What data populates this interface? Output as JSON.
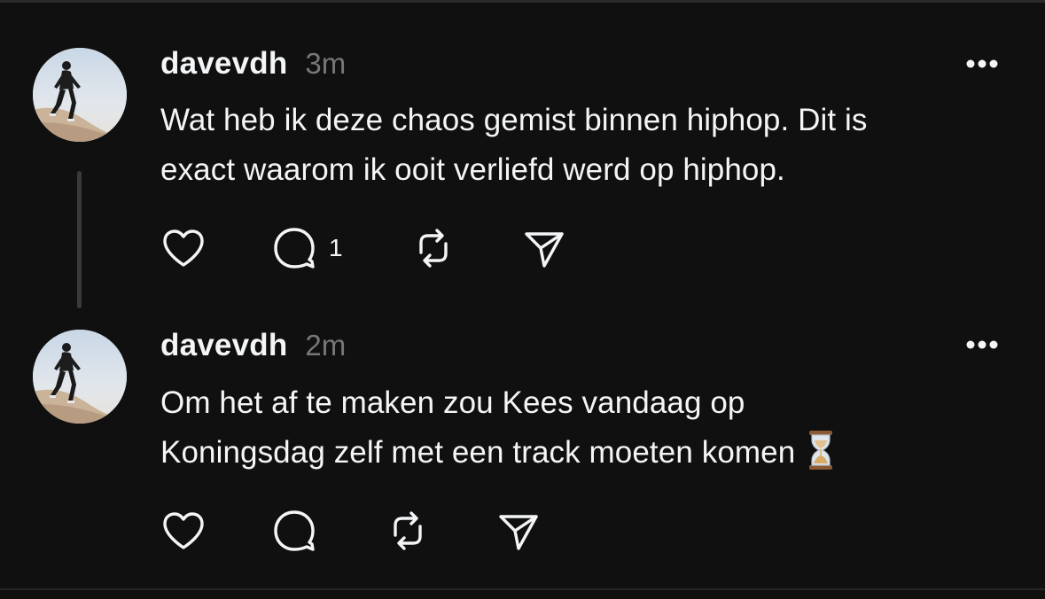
{
  "thread": {
    "posts": [
      {
        "username": "davevdh",
        "time": "3m",
        "text_line1": "Wat heb ik deze chaos gemist binnen hiphop. Dit is",
        "text_line2": "exact waarom ik ooit verliefd werd op hiphop.",
        "reply_count": "1",
        "icons": [
          "heart-icon",
          "comment-icon",
          "repost-icon",
          "share-icon",
          "more-icon"
        ]
      },
      {
        "username": "davevdh",
        "time": "2m",
        "text_line1": "Om het af te maken zou Kees vandaag op",
        "text_line2": "Koningsdag zelf met een track moeten komen",
        "emoji": "hourglass-icon",
        "icons": [
          "heart-icon",
          "comment-icon",
          "repost-icon",
          "share-icon",
          "more-icon"
        ]
      }
    ]
  },
  "colors": {
    "background": "#101010",
    "text": "#f3f5f7",
    "muted": "#777777",
    "thread_line": "#3a3a3a"
  }
}
